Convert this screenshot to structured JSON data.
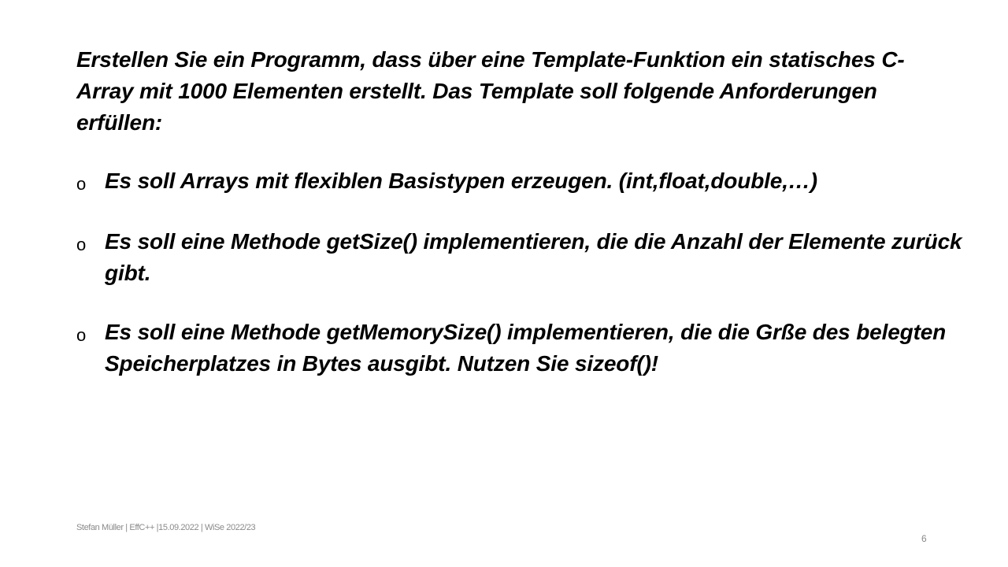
{
  "slide": {
    "intro": "Erstellen Sie ein Programm, dass über eine Template-Funktion ein statisches C-Array mit 1000 Elementen erstellt. Das Template soll folgende Anforderungen erfüllen:",
    "bullet_marker": "o",
    "bullets": [
      "Es soll Arrays mit flexiblen Basistypen erzeugen. (int,float,double,…)",
      "Es soll eine Methode getSize()  implementieren, die die Anzahl der Elemente zurück gibt.",
      "Es soll eine Methode getMemorySize()  implementieren, die die Grße des belegten Speicherplatzes in Bytes ausgibt. Nutzen Sie sizeof()!"
    ]
  },
  "footer": {
    "meta": "Stefan Müller | EffC++ |15.09.2022 | WiSe 2022/23",
    "page_number": "6"
  }
}
